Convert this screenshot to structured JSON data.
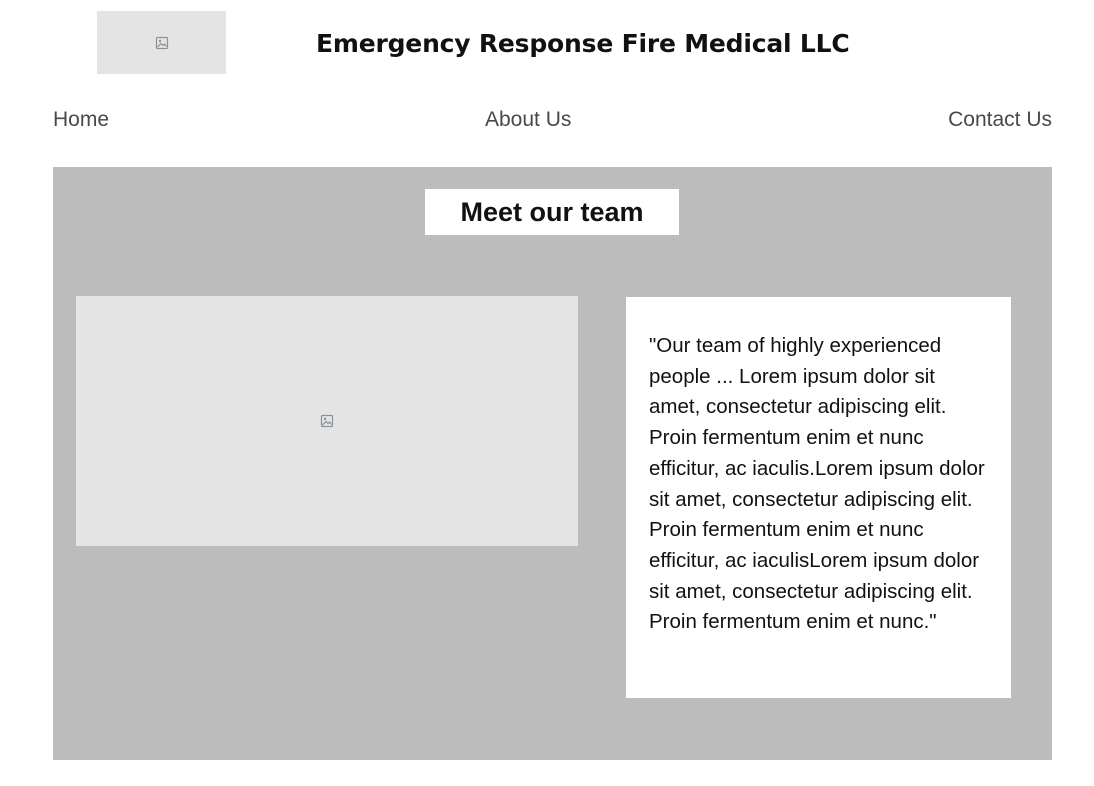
{
  "header": {
    "logo_icon": "image-placeholder-icon",
    "title": "Emergency Response Fire Medical LLC"
  },
  "nav": {
    "home": "Home",
    "about": "About Us",
    "contact": "Contact Us"
  },
  "team": {
    "heading": "Meet our team",
    "photo_icon": "image-placeholder-icon",
    "quote": "\"Our team of highly experienced people ... Lorem ipsum dolor sit amet, consectetur adipiscing elit. Proin fermentum enim et nunc efficitur, ac iaculis.Lorem ipsum dolor sit amet, consectetur adipiscing elit. Proin fermentum enim et nunc efficitur, ac iaculisLorem ipsum dolor sit amet, consectetur adipiscing elit. Proin fermentum enim et nunc.\""
  },
  "colors": {
    "section_background": "#bcbcbc",
    "placeholder_background": "#e4e4e4",
    "nav_text": "#454a4e",
    "text": "#111111"
  }
}
